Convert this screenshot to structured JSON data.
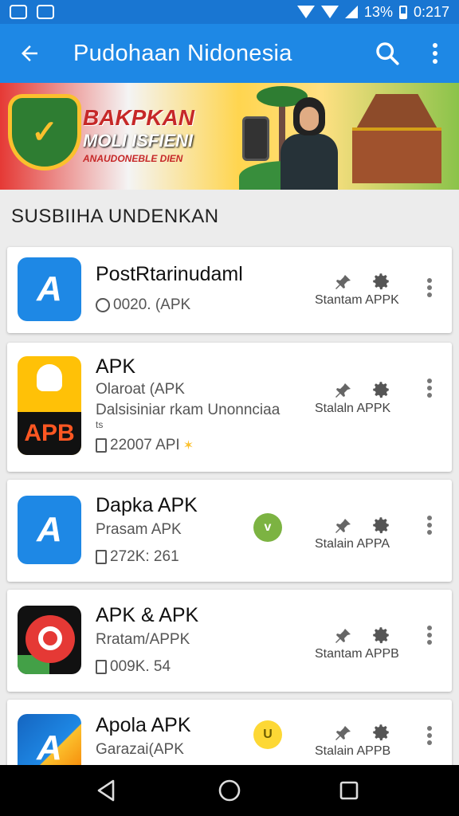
{
  "status_bar": {
    "battery_text": "13%",
    "time": "0:217"
  },
  "app_bar": {
    "title": "Pudohaan Nidonesia",
    "back_icon": "arrow-left-icon",
    "search_icon": "search-icon",
    "menu_icon": "more-vert-icon"
  },
  "banner": {
    "line1": "BAKPKAN",
    "line2": "MOLI ISFIENI",
    "line3": "ANAUDONEBLE DIEN"
  },
  "section": {
    "title": "SUSBIIHA UNDENKAN"
  },
  "apps": [
    {
      "name": "PostRtarinudaml",
      "lines": [],
      "meta": "0020. (APK",
      "meta_icon": "clock-icon",
      "badge": null,
      "action_label": "Stantam APPK",
      "icon": "blue-a-icon"
    },
    {
      "name": "APK",
      "lines": [
        "Olaroat (APK",
        "Dalsisiniar rkam Unonnciaa",
        "ts"
      ],
      "meta": "22007 API",
      "meta_icon": "file-icon",
      "badge": null,
      "action_label": "Stalaln APPK",
      "icon": "apb-icon",
      "icon_text": "APB"
    },
    {
      "name": "Dapka APK",
      "lines": [
        "Prasam APK"
      ],
      "meta": "272K: 261",
      "meta_icon": "file-icon",
      "badge": "v",
      "badge_color": "#7cb342",
      "action_label": "Stalain APPA",
      "icon": "blue-a-icon"
    },
    {
      "name": "APK & APK",
      "lines": [
        "Rratam/APPK"
      ],
      "meta": "009K. 54",
      "meta_icon": "file-icon",
      "badge": null,
      "action_label": "Stantam APPB",
      "icon": "red-spiral-icon"
    },
    {
      "name": "Apola APK",
      "lines": [
        "Garazai(APK"
      ],
      "meta": "",
      "meta_icon": null,
      "badge": "U",
      "badge_color": "#fdd835",
      "action_label": "Stalain APPB",
      "icon": "multicolor-a-icon"
    }
  ],
  "nav_bar": {
    "back": "triangle-back-icon",
    "home": "circle-home-icon",
    "recents": "square-recents-icon"
  },
  "colors": {
    "primary": "#1e88e5",
    "status_bar": "#1976d2"
  }
}
